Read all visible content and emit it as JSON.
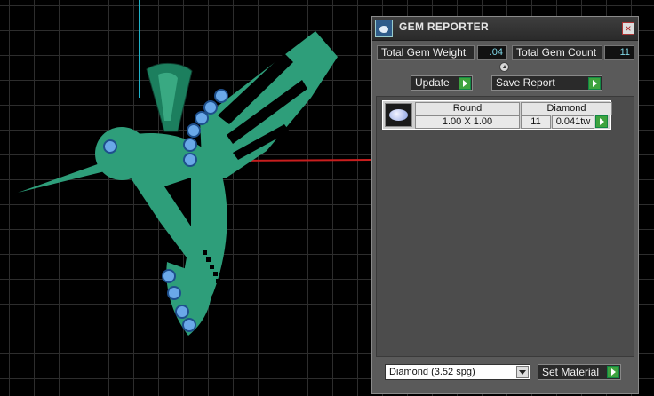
{
  "viewport": {
    "grid_color": "#2d2d2d",
    "axis_y_color": "#1fb1c8",
    "axis_x_color": "#c81e1e",
    "model_color": "#2e9e7a",
    "gem_color": "#6aa8e8"
  },
  "panel": {
    "title": "GEM REPORTER",
    "close_glyph": "×",
    "total_weight_label": "Total Gem Weight",
    "total_weight_value": ".04",
    "total_count_label": "Total Gem Count",
    "total_count_value": "11",
    "update_label": "Update",
    "save_report_label": "Save Report",
    "gem_rows": [
      {
        "shape": "Round",
        "size": "1.00 X 1.00",
        "material": "Diamond",
        "count": "11",
        "weight": "0.041tw"
      }
    ],
    "material_select_value": "Diamond     (3.52 spg)",
    "set_material_label": "Set Material",
    "accent_play": "#3ea33e"
  }
}
